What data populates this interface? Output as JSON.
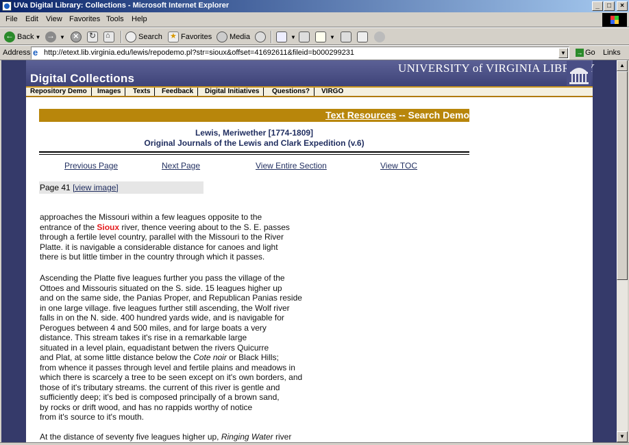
{
  "window": {
    "title": "UVa Digital Library: Collections - Microsoft Internet Explorer",
    "minimize": "_",
    "maximize": "□",
    "close": "×"
  },
  "menu": [
    "File",
    "Edit",
    "View",
    "Favorites",
    "Tools",
    "Help"
  ],
  "toolbar": {
    "back": "Back",
    "search": "Search",
    "favorites": "Favorites",
    "media": "Media"
  },
  "address": {
    "label": "Address",
    "url": "http://etext.lib.virginia.edu/lewis/repodemo.pl?str=sioux&offset=41692611&fileid=b000299231",
    "go": "Go",
    "links": "Links"
  },
  "site": {
    "title": "Digital Collections",
    "university": "UNIVERSITY of VIRGINIA LIBRARY",
    "nav": [
      "Repository Demo",
      "Images",
      "Texts",
      "Feedback",
      "Digital Initiatives",
      "Questions?",
      "VIRGO"
    ]
  },
  "header": {
    "section_link": "Text Resources",
    "section_rest": "-- Search Demo",
    "author": "Lewis, Meriwether [1774-1809]",
    "work": "Original Journals of the Lewis and Clark Expedition (v.6)"
  },
  "pagenav": {
    "previous": "Previous Page",
    "next": "Next Page",
    "section": "View Entire Section",
    "toc": "View TOC"
  },
  "pageinfo": {
    "label": "Page 41",
    "image_link": "[view image]"
  },
  "text": {
    "p1": {
      "l1": "approaches the Missouri within a few leagues opposite to the",
      "l2_pre": "entrance of the ",
      "l2_hl": "Sioux",
      "l2_post": " river, thence veering about to the S. E. passes",
      "l3": "through a fertile level country, parallel with the Missouri to the River",
      "l4": "Platte. it is navigable a considerable distance for canoes and light",
      "l5": "there is but little timber in the country through which it passes."
    },
    "p2": {
      "l1": "Ascending the Platte five leagues further you pass the village of the",
      "l2": "Ottoes and Missouris situated on the S. side. 15 leagues higher up",
      "l3": "and on the same side, the Panias Proper, and Republican Panias reside",
      "l4": "in one large village. five leagues further still ascending, the Wolf river",
      "l5": "falls in on the N. side. 400 hundred yards wide, and is navigable for",
      "l6": "Perogues between 4 and 500 miles, and for large boats a very",
      "l7": "distance. This stream takes it's rise in a remarkable large",
      "l8": "situated in a level plain, equadistant betwen the rivers Quicurre",
      "l9_pre": "and Plat, at some little distance below the ",
      "l9_em": "Cote noir",
      "l9_post": " or Black Hills;",
      "l10": "from whence it passes through level and fertile plains and meadows in",
      "l11": "which there is scarcely a tree to be seen except on it's own borders, and",
      "l12": "those of it's tributary streams. the current of this river is gentle and",
      "l13": "sufficiently deep; it's bed is composed principally of a brown sand,",
      "l14": "by rocks or drift wood, and has no rappids worthy of notice",
      "l15": "from it's source to it's mouth."
    },
    "p3": {
      "l1_pre": "At the distance of seventy five leagues higher up, ",
      "l1_em": "Ringing Water",
      "l1_post": " river"
    }
  },
  "colors": {
    "frame": "#353a6a",
    "banner": "#4a4f86",
    "gold": "#b8860b",
    "highlight": "#e41a1c",
    "link": "#1e2c5e"
  }
}
